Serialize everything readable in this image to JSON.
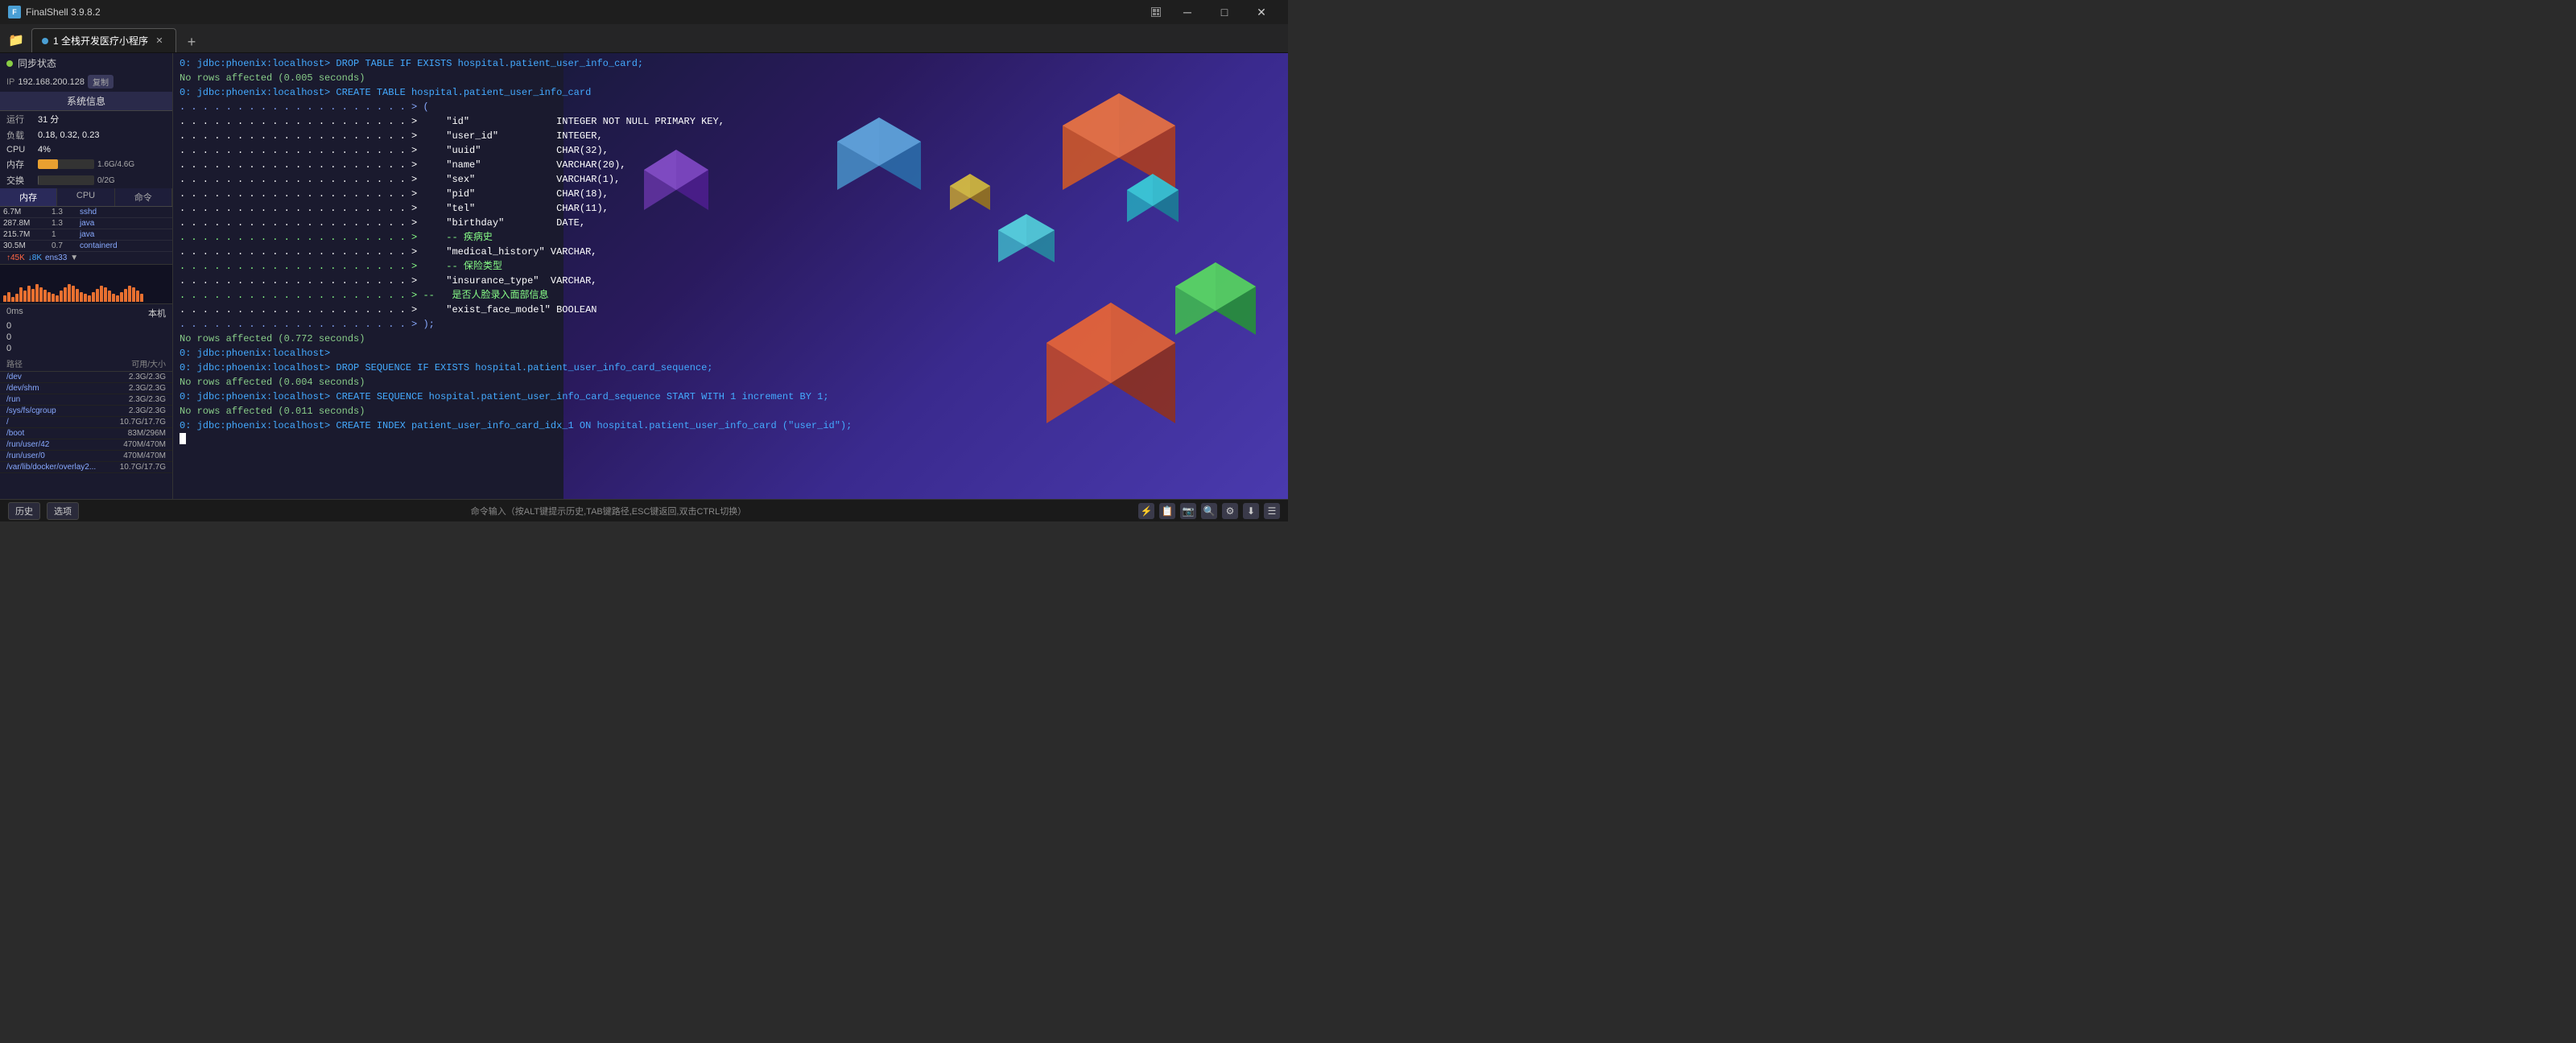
{
  "titlebar": {
    "app_name": "FinalShell 3.9.8.2",
    "minimize_label": "─",
    "maximize_label": "□",
    "close_label": "✕"
  },
  "tabbar": {
    "tab_label": "1 全栈开发医疗小程序",
    "add_label": "+"
  },
  "sidebar": {
    "sync_label": "同步状态",
    "ip_label": "IP",
    "ip_value": "192.168.200.128",
    "copy_label": "复制",
    "sysinfo_label": "系统信息",
    "runtime_label": "运行",
    "runtime_value": "31 分",
    "load_label": "负载",
    "load_value": "0.18, 0.32, 0.23",
    "cpu_label": "CPU",
    "cpu_value": "4%",
    "mem_label": "内存",
    "mem_percent": "36%",
    "mem_value": "1.6G/4.6G",
    "swap_label": "交换",
    "swap_percent": "0%",
    "swap_value": "0/2G",
    "tab_mem": "内存",
    "tab_cpu": "CPU",
    "tab_cmd": "命令",
    "processes": [
      {
        "mem": "6.7M",
        "cpu": "1.3",
        "name": "sshd"
      },
      {
        "mem": "287.8M",
        "cpu": "1.3",
        "name": "java"
      },
      {
        "mem": "215.7M",
        "cpu": "1",
        "name": "java"
      },
      {
        "mem": "30.5M",
        "cpu": "0.7",
        "name": "containerd"
      }
    ],
    "net_up": "↑45K",
    "net_down": "↓8K",
    "net_iface": "ens33",
    "latency_label": "0ms",
    "local_label": "本机",
    "latency_vals": [
      "0",
      "0",
      "0"
    ],
    "disk_header_path": "路径",
    "disk_header_size": "可用/大小",
    "disks": [
      {
        "path": "/dev",
        "size": "2.3G/2.3G"
      },
      {
        "path": "/dev/shm",
        "size": "2.3G/2.3G"
      },
      {
        "path": "/run",
        "size": "2.3G/2.3G"
      },
      {
        "path": "/sys/fs/cgroup",
        "size": "2.3G/2.3G"
      },
      {
        "path": "/",
        "size": "10.7G/17.7G"
      },
      {
        "path": "/boot",
        "size": "83M/296M"
      },
      {
        "path": "/run/user/42",
        "size": "470M/470M"
      },
      {
        "path": "/run/user/0",
        "size": "470M/470M"
      },
      {
        "path": "/var/lib/docker/overlay2...",
        "size": "10.7G/17.7G"
      }
    ]
  },
  "terminal": {
    "lines": [
      {
        "type": "prompt",
        "content": "0: jdbc:phoenix:localhost> DROP TABLE IF EXISTS hospital.patient_user_info_card;"
      },
      {
        "type": "ok",
        "content": "No rows affected (0.005 seconds)"
      },
      {
        "type": "prompt",
        "content": "0: jdbc:phoenix:localhost> CREATE TABLE hospital.patient_user_info_card"
      },
      {
        "type": "dots",
        "content": ". . . . . . . . . . . . . . . . . . . . > ("
      },
      {
        "type": "field",
        "content": ". . . . . . . . . . . . . . . . . . . . >     \"id\"               INTEGER NOT NULL PRIMARY KEY,"
      },
      {
        "type": "field",
        "content": ". . . . . . . . . . . . . . . . . . . . >     \"user_id\"          INTEGER,"
      },
      {
        "type": "field",
        "content": ". . . . . . . . . . . . . . . . . . . . >     \"uuid\"             CHAR(32),"
      },
      {
        "type": "field",
        "content": ". . . . . . . . . . . . . . . . . . . . >     \"name\"             VARCHAR(20),"
      },
      {
        "type": "field",
        "content": ". . . . . . . . . . . . . . . . . . . . >     \"sex\"              VARCHAR(1),"
      },
      {
        "type": "field",
        "content": ". . . . . . . . . . . . . . . . . . . . >     \"pid\"              CHAR(18),"
      },
      {
        "type": "field",
        "content": ". . . . . . . . . . . . . . . . . . . . >     \"tel\"              CHAR(11),"
      },
      {
        "type": "field",
        "content": ". . . . . . . . . . . . . . . . . . . . >     \"birthday\"         DATE,"
      },
      {
        "type": "comment",
        "content": ". . . . . . . . . . . . . . . . . . . . >     -- 疾病史"
      },
      {
        "type": "field",
        "content": ". . . . . . . . . . . . . . . . . . . . >     \"medical_history\" VARCHAR,"
      },
      {
        "type": "comment",
        "content": ". . . . . . . . . . . . . . . . . . . . >     -- 保险类型"
      },
      {
        "type": "field",
        "content": ". . . . . . . . . . . . . . . . . . . . >     \"insurance_type\"  VARCHAR,"
      },
      {
        "type": "comment",
        "content": ". . . . . . . . . . . . . . . . . . . . > --   是否人脸录入面部信息"
      },
      {
        "type": "field",
        "content": ". . . . . . . . . . . . . . . . . . . . >     \"exist_face_model\" BOOLEAN"
      },
      {
        "type": "dots",
        "content": ". . . . . . . . . . . . . . . . . . . . > );"
      },
      {
        "type": "ok",
        "content": "No rows affected (0.772 seconds)"
      },
      {
        "type": "prompt",
        "content": "0: jdbc:phoenix:localhost>"
      },
      {
        "type": "prompt",
        "content": "0: jdbc:phoenix:localhost> DROP SEQUENCE IF EXISTS hospital.patient_user_info_card_sequence;"
      },
      {
        "type": "ok",
        "content": "No rows affected (0.004 seconds)"
      },
      {
        "type": "prompt",
        "content": "0: jdbc:phoenix:localhost> CREATE SEQUENCE hospital.patient_user_info_card_sequence START WITH 1 increment BY 1;"
      },
      {
        "type": "ok",
        "content": "No rows affected (0.011 seconds)"
      },
      {
        "type": "prompt",
        "content": "0: jdbc:phoenix:localhost> CREATE INDEX patient_user_info_card_idx_1 ON hospital.patient_user_info_card (\"user_id\");"
      }
    ]
  },
  "statusbar": {
    "hint": "命令输入（按ALT键提示历史,TAB键路径,ESC键返回,双击CTRL切换）",
    "btn_history": "历史",
    "btn_select": "选项",
    "icons": [
      "⚡",
      "📋",
      "📋",
      "🔍",
      "⚙",
      "⬇",
      "☰"
    ]
  }
}
